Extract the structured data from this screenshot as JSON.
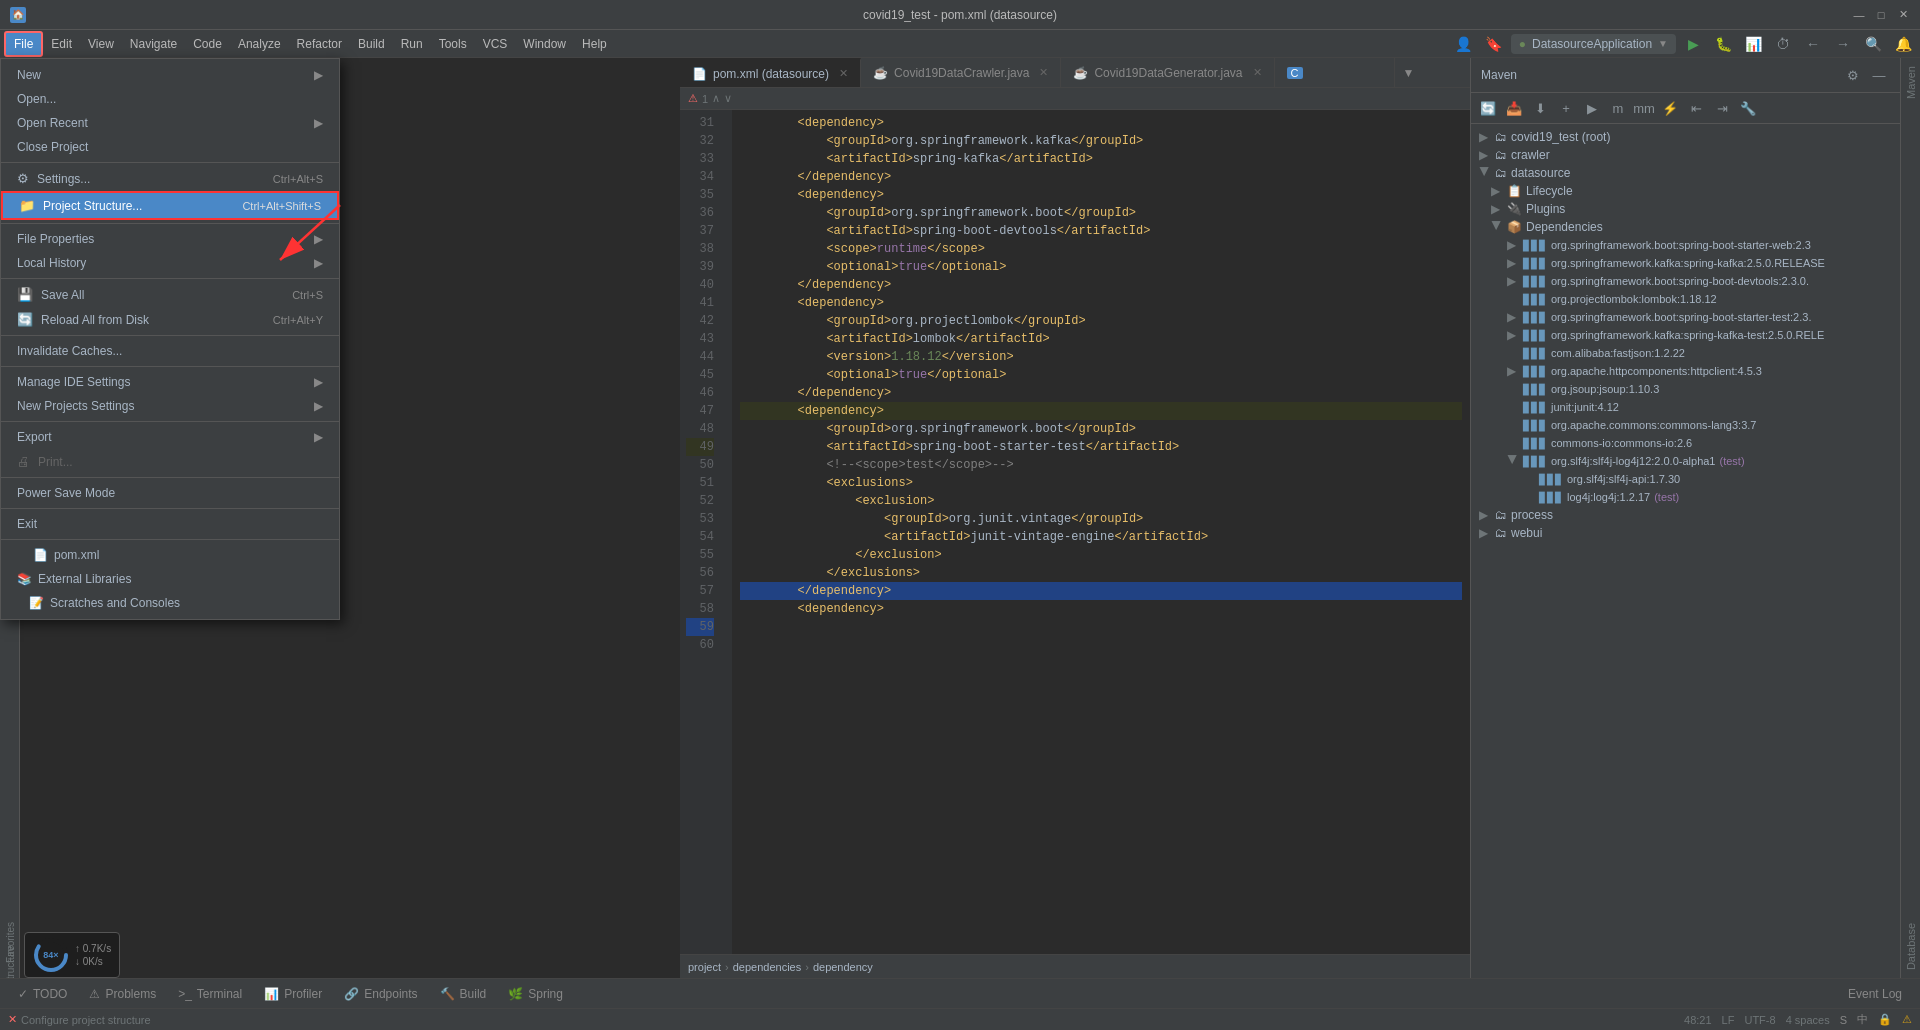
{
  "titleBar": {
    "title": "covid19_test - pom.xml (datasource)",
    "minimize": "—",
    "maximize": "□",
    "close": "✕"
  },
  "menuBar": {
    "items": [
      "File",
      "Edit",
      "View",
      "Navigate",
      "Code",
      "Analyze",
      "Refactor",
      "Build",
      "Run",
      "Tools",
      "VCS",
      "Window",
      "Help"
    ]
  },
  "fileMenu": {
    "items": [
      {
        "id": "new",
        "label": "New",
        "shortcut": "",
        "hasArrow": true,
        "icon": ""
      },
      {
        "id": "open",
        "label": "Open...",
        "shortcut": "",
        "hasArrow": false,
        "icon": ""
      },
      {
        "id": "open-recent",
        "label": "Open Recent",
        "shortcut": "",
        "hasArrow": true,
        "icon": ""
      },
      {
        "id": "close-project",
        "label": "Close Project",
        "shortcut": "",
        "hasArrow": false,
        "icon": ""
      },
      {
        "id": "sep1",
        "type": "separator"
      },
      {
        "id": "settings",
        "label": "Settings...",
        "shortcut": "Ctrl+Alt+S",
        "hasArrow": false,
        "icon": "⚙"
      },
      {
        "id": "project-structure",
        "label": "Project Structure...",
        "shortcut": "Ctrl+Alt+Shift+S",
        "hasArrow": false,
        "highlighted": true,
        "icon": "📁"
      },
      {
        "id": "sep2",
        "type": "separator"
      },
      {
        "id": "file-properties",
        "label": "File Properties",
        "shortcut": "",
        "hasArrow": true,
        "icon": ""
      },
      {
        "id": "local-history",
        "label": "Local History",
        "shortcut": "",
        "hasArrow": true,
        "icon": ""
      },
      {
        "id": "sep3",
        "type": "separator"
      },
      {
        "id": "save-all",
        "label": "Save All",
        "shortcut": "Ctrl+S",
        "hasArrow": false,
        "icon": "💾"
      },
      {
        "id": "reload",
        "label": "Reload All from Disk",
        "shortcut": "Ctrl+Alt+Y",
        "hasArrow": false,
        "icon": "🔄"
      },
      {
        "id": "sep4",
        "type": "separator"
      },
      {
        "id": "invalidate",
        "label": "Invalidate Caches...",
        "shortcut": "",
        "hasArrow": false,
        "icon": ""
      },
      {
        "id": "sep5",
        "type": "separator"
      },
      {
        "id": "manage-ide",
        "label": "Manage IDE Settings",
        "shortcut": "",
        "hasArrow": true,
        "icon": ""
      },
      {
        "id": "new-projects",
        "label": "New Projects Settings",
        "shortcut": "",
        "hasArrow": true,
        "icon": ""
      },
      {
        "id": "sep6",
        "type": "separator"
      },
      {
        "id": "export",
        "label": "Export",
        "shortcut": "",
        "hasArrow": true,
        "icon": ""
      },
      {
        "id": "print",
        "label": "Print...",
        "shortcut": "",
        "hasArrow": false,
        "disabled": true,
        "icon": "🖨"
      },
      {
        "id": "sep7",
        "type": "separator"
      },
      {
        "id": "power-save",
        "label": "Power Save Mode",
        "shortcut": "",
        "hasArrow": false,
        "icon": ""
      },
      {
        "id": "sep8",
        "type": "separator"
      },
      {
        "id": "exit",
        "label": "Exit",
        "shortcut": "",
        "hasArrow": false,
        "icon": ""
      }
    ]
  },
  "projectTree": {
    "items": [
      {
        "label": "pom.xml",
        "icon": "📄",
        "indent": 1
      },
      {
        "label": "External Libraries",
        "icon": "📚",
        "indent": 0
      },
      {
        "label": "Scratches and Consoles",
        "icon": "📝",
        "indent": 0
      }
    ]
  },
  "editorTabs": [
    {
      "id": "pom-xml",
      "label": "pom.xml (datasource)",
      "icon": "📄",
      "active": true,
      "color": "#d4a017"
    },
    {
      "id": "crawler-java",
      "label": "Covid19DataCrawler.java",
      "icon": "☕",
      "active": false,
      "color": "#f0a030"
    },
    {
      "id": "generator-java",
      "label": "Covid19DataGenerator.java",
      "icon": "☕",
      "active": false,
      "color": "#f0a030"
    },
    {
      "id": "extra",
      "label": "C",
      "icon": "",
      "active": false
    }
  ],
  "codeLines": [
    {
      "num": "31",
      "content": "        <dependency>",
      "type": "tag"
    },
    {
      "num": "32",
      "content": "            <groupId>org.springframework.kafka</groupId>",
      "type": "tag"
    },
    {
      "num": "33",
      "content": "            <artifactId>spring-kafka</artifactId>",
      "type": "tag"
    },
    {
      "num": "34",
      "content": "        </dependency>",
      "type": "tag"
    },
    {
      "num": "35",
      "content": ""
    },
    {
      "num": "36",
      "content": ""
    },
    {
      "num": "37",
      "content": "        <dependency>",
      "type": "tag"
    },
    {
      "num": "38",
      "content": "            <groupId>org.springframework.boot</groupId>",
      "type": "tag"
    },
    {
      "num": "39",
      "content": "            <artifactId>spring-boot-devtools</artifactId>",
      "type": "tag"
    },
    {
      "num": "40",
      "content": "            <scope>runtime</scope>",
      "type": "mixed"
    },
    {
      "num": "41",
      "content": "            <optional>true</optional>",
      "type": "mixed"
    },
    {
      "num": "42",
      "content": "        </dependency>",
      "type": "tag"
    },
    {
      "num": "43",
      "content": "        <dependency>",
      "type": "tag"
    },
    {
      "num": "44",
      "content": "            <groupId>org.projectlombok</groupId>",
      "type": "tag"
    },
    {
      "num": "45",
      "content": "            <artifactId>lombok</artifactId>",
      "type": "tag"
    },
    {
      "num": "46",
      "content": "            <version>1.18.12</version>",
      "type": "mixed"
    },
    {
      "num": "47",
      "content": "            <optional>true</optional>",
      "type": "mixed"
    },
    {
      "num": "48",
      "content": "        </dependency>",
      "type": "tag"
    },
    {
      "num": "49",
      "content": "        <dependency>",
      "type": "tag",
      "selected": true
    },
    {
      "num": "50",
      "content": "            <groupId>org.springframework.boot</groupId>",
      "type": "tag"
    },
    {
      "num": "51",
      "content": "            <artifactId>spring-boot-starter-test</artifactId>",
      "type": "tag"
    },
    {
      "num": "52",
      "content": "            <!--<scope>test</scope>-->",
      "type": "comment"
    },
    {
      "num": "53",
      "content": "            <exclusions>",
      "type": "tag"
    },
    {
      "num": "54",
      "content": "                <exclusion>",
      "type": "tag"
    },
    {
      "num": "55",
      "content": "                    <groupId>org.junit.vintage</groupId>",
      "type": "tag"
    },
    {
      "num": "56",
      "content": "                    <artifactId>junit-vintage-engine</artifactId>",
      "type": "tag"
    },
    {
      "num": "57",
      "content": "                </exclusion>",
      "type": "tag"
    },
    {
      "num": "58",
      "content": "            </exclusions>",
      "type": "tag"
    },
    {
      "num": "59",
      "content": "        </dependency>",
      "type": "tag",
      "highlighted2": true
    },
    {
      "num": "60",
      "content": "        <dependency>",
      "type": "tag"
    }
  ],
  "breadcrumb": {
    "items": [
      "project",
      "dependencies",
      "dependency"
    ]
  },
  "mavenPanel": {
    "title": "Maven",
    "tree": [
      {
        "label": "covid19_test (root)",
        "icon": "🗂",
        "indent": 0,
        "hasArrow": true,
        "expanded": false
      },
      {
        "label": "crawler",
        "icon": "🗂",
        "indent": 0,
        "hasArrow": true,
        "expanded": false
      },
      {
        "label": "datasource",
        "icon": "🗂",
        "indent": 0,
        "hasArrow": false,
        "expanded": true
      },
      {
        "label": "Lifecycle",
        "icon": "📋",
        "indent": 1,
        "hasArrow": true,
        "expanded": false
      },
      {
        "label": "Plugins",
        "icon": "🔌",
        "indent": 1,
        "hasArrow": true,
        "expanded": false
      },
      {
        "label": "Dependencies",
        "icon": "📦",
        "indent": 1,
        "hasArrow": false,
        "expanded": true
      },
      {
        "label": "org.springframework.boot:spring-boot-starter-web:2.3",
        "indent": 2,
        "hasArrow": true
      },
      {
        "label": "org.springframework.kafka:spring-kafka:2.5.0.RELEASE",
        "indent": 2,
        "hasArrow": true
      },
      {
        "label": "org.springframework.boot:spring-boot-devtools:2.3.0.",
        "indent": 2,
        "hasArrow": true
      },
      {
        "label": "org.projectlombok:lombok:1.18.12",
        "indent": 2,
        "hasArrow": false
      },
      {
        "label": "org.springframework.boot:spring-boot-starter-test:2.3.",
        "indent": 2,
        "hasArrow": true
      },
      {
        "label": "org.springframework.kafka:spring-kafka-test:2.5.0.RELE",
        "indent": 2,
        "hasArrow": true
      },
      {
        "label": "com.alibaba:fastjson:1.2.22",
        "indent": 2,
        "hasArrow": false
      },
      {
        "label": "org.apache.httpcomponents:httpclient:4.5.3",
        "indent": 2,
        "hasArrow": true
      },
      {
        "label": "org.jsoup:jsoup:1.10.3",
        "indent": 2,
        "hasArrow": false
      },
      {
        "label": "junit:junit:4.12",
        "indent": 2,
        "hasArrow": false
      },
      {
        "label": "org.apache.commons:commons-lang3:3.7",
        "indent": 2,
        "hasArrow": false
      },
      {
        "label": "commons-io:commons-io:2.6",
        "indent": 2,
        "hasArrow": false
      },
      {
        "label": "org.slf4j:slf4j-log4j12:2.0.0-alpha1 (test)",
        "indent": 2,
        "hasArrow": false,
        "isExpanded": true
      },
      {
        "label": "org.slf4j:slf4j-api:1.7.30",
        "indent": 3,
        "hasArrow": false
      },
      {
        "label": "log4j:log4j:1.2.17 (test)",
        "indent": 3,
        "hasArrow": false,
        "isTest": true
      },
      {
        "label": "process",
        "icon": "🗂",
        "indent": 0,
        "hasArrow": true,
        "expanded": false
      },
      {
        "label": "webui",
        "icon": "🗂",
        "indent": 0,
        "hasArrow": true,
        "expanded": false
      }
    ]
  },
  "bottomTabs": [
    {
      "id": "todo",
      "label": "TODO",
      "icon": "✓"
    },
    {
      "id": "problems",
      "label": "Problems",
      "icon": "⚠"
    },
    {
      "id": "terminal",
      "label": "Terminal",
      "icon": ">"
    },
    {
      "id": "profiler",
      "label": "Profiler",
      "icon": "📊"
    },
    {
      "id": "endpoints",
      "label": "Endpoints",
      "icon": "🔗"
    },
    {
      "id": "build",
      "label": "Build",
      "icon": "🔨"
    },
    {
      "id": "spring",
      "label": "Spring",
      "icon": "🌿"
    }
  ],
  "statusBar": {
    "left": "Configure project structure",
    "right": {
      "line": "48:21",
      "encoding": "UTF-8",
      "indent": "4 spaces",
      "lf": "LF"
    }
  },
  "performanceWidget": {
    "percent": "84×",
    "network1": "0.7K/s",
    "network2": "0K/s"
  },
  "toolbar": {
    "runConfig": "DatasourceApplication",
    "searchIcon": "🔍",
    "gearIcon": "⚙"
  }
}
